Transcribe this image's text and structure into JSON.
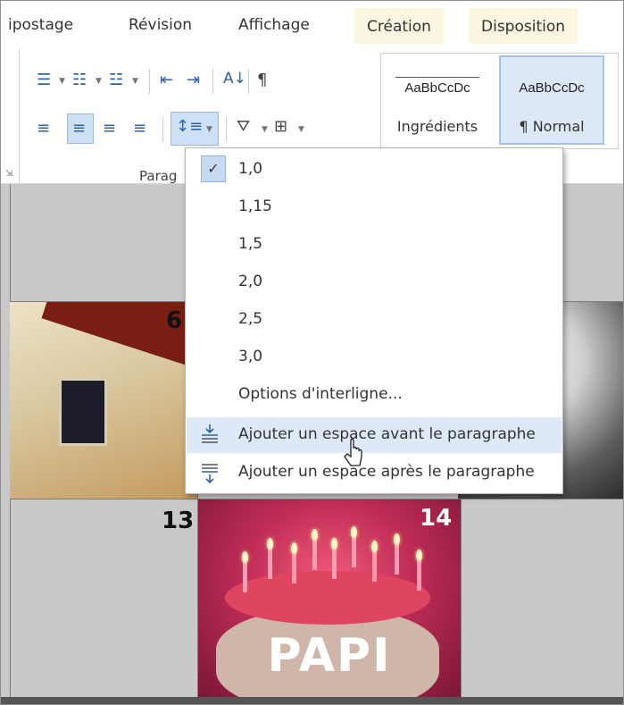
{
  "ribbon": {
    "tabs": [
      "ipostage",
      "Révision",
      "Affichage",
      "Création",
      "Disposition"
    ],
    "paragraph_group_label": "Parag",
    "styles": [
      {
        "sample": "AaBbCcDc",
        "name": "Ingrédients"
      },
      {
        "sample": "AaBbCcDc",
        "name": "¶ Normal"
      }
    ],
    "icons": [
      "bullets-icon",
      "numbering-icon",
      "multilevel-list-icon",
      "decrease-indent-icon",
      "increase-indent-icon",
      "sort-icon",
      "pilcrow-icon",
      "align-left-icon",
      "align-center-icon",
      "align-right-icon",
      "justify-icon",
      "line-spacing-icon",
      "shading-icon",
      "borders-icon"
    ]
  },
  "menu": {
    "checked": "1,0",
    "items": [
      "1,0",
      "1,15",
      "1,5",
      "2,0",
      "2,5",
      "3,0"
    ],
    "options_label": "Options d'interligne...",
    "add_before": "Ajouter un espace avant le paragraphe",
    "add_after": "Ajouter un espace après le paragraphe"
  },
  "document": {
    "numbers": [
      "6",
      "13",
      "14"
    ],
    "cake_text": "PAPI"
  },
  "colors": {
    "accent": "#2f62a8",
    "menu_hover": "#dde9f6",
    "doc_bg": "#c9c9c9"
  }
}
